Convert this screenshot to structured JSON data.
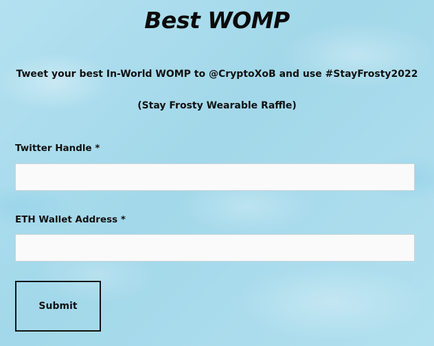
{
  "form": {
    "title": "Best WOMP",
    "description_line1": "Tweet your best In-World WOMP to @CryptoXoB and use #StayFrosty2022",
    "description_line2": "(Stay Frosty Wearable Raffle)",
    "fields": [
      {
        "label": "Twitter Handle *",
        "value": "",
        "placeholder": ""
      },
      {
        "label": "ETH Wallet Address *",
        "value": "",
        "placeholder": ""
      }
    ],
    "submit_label": "Submit"
  },
  "colors": {
    "background": "#a9dcec",
    "text": "#111111",
    "input_background": "#fafafa"
  }
}
